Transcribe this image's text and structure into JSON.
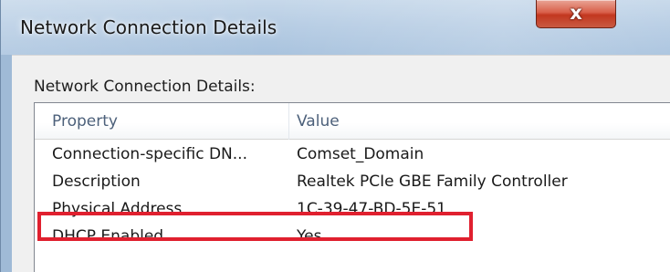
{
  "window": {
    "title": "Network Connection Details",
    "close_icon": "x-icon",
    "close_glyph": "x"
  },
  "group_label": "Network Connection Details:",
  "list": {
    "columns": [
      "Property",
      "Value"
    ],
    "rows": [
      {
        "property": "Connection-specific DN...",
        "value": "Comset_Domain"
      },
      {
        "property": "Description",
        "value": "Realtek PCIe GBE Family Controller"
      },
      {
        "property": "Physical Address",
        "value": "1C-39-47-BD-5E-51"
      },
      {
        "property": "DHCP Enabled",
        "value": "Yes"
      }
    ]
  },
  "highlight": {
    "row_label": "Physical Address",
    "color": "#e0202f"
  }
}
